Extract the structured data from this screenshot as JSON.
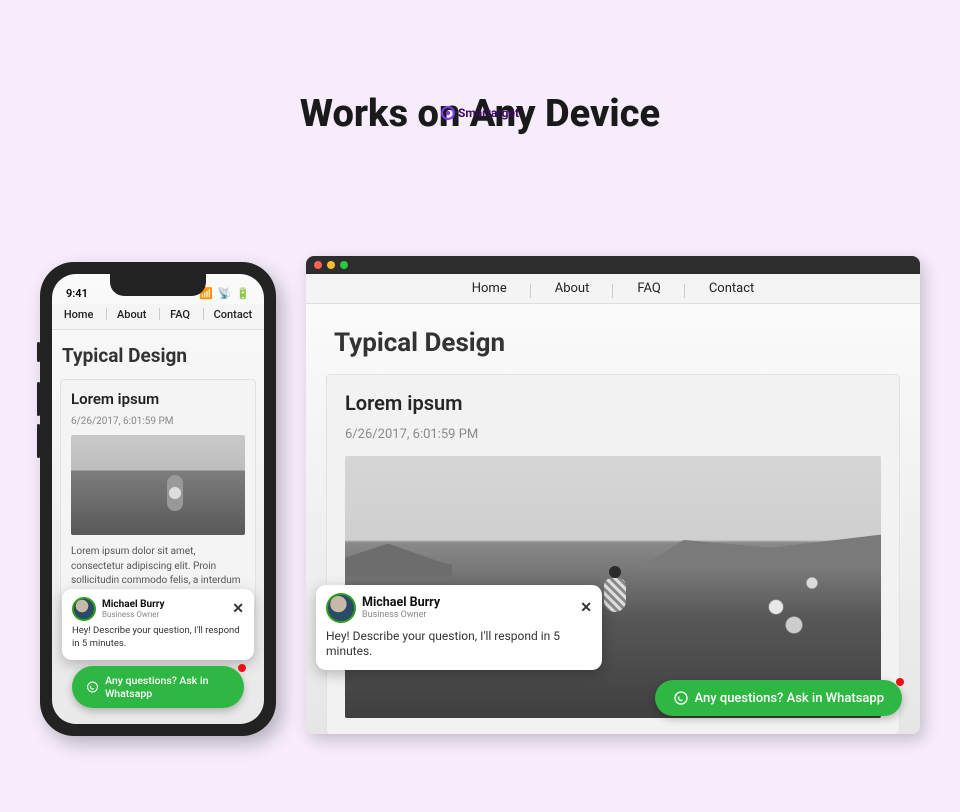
{
  "brand": {
    "name": "Smartarget"
  },
  "heading": "Works on Any Device",
  "nav": {
    "home": "Home",
    "about": "About",
    "faq": "FAQ",
    "contact": "Contact"
  },
  "page": {
    "title": "Typical Design",
    "post_title": "Lorem ipsum",
    "date": "6/26/2017, 6:01:59 PM",
    "body": "Lorem ipsum dolor sit amet, consectetur adipiscing elit. Proin sollicitudin commodo felis, a interdum mauris mattis tempus. In"
  },
  "status": {
    "time": "9:41",
    "signal": "▮▮▮▮",
    "wifi": "᯾",
    "battery": "▮▮"
  },
  "chat": {
    "name": "Michael Burry",
    "role": "Business Owner",
    "message": "Hey! Describe your question, I'll respond in 5 minutes.",
    "close": "✕"
  },
  "whatsapp": {
    "label": "Any questions? Ask in Whatsapp"
  }
}
